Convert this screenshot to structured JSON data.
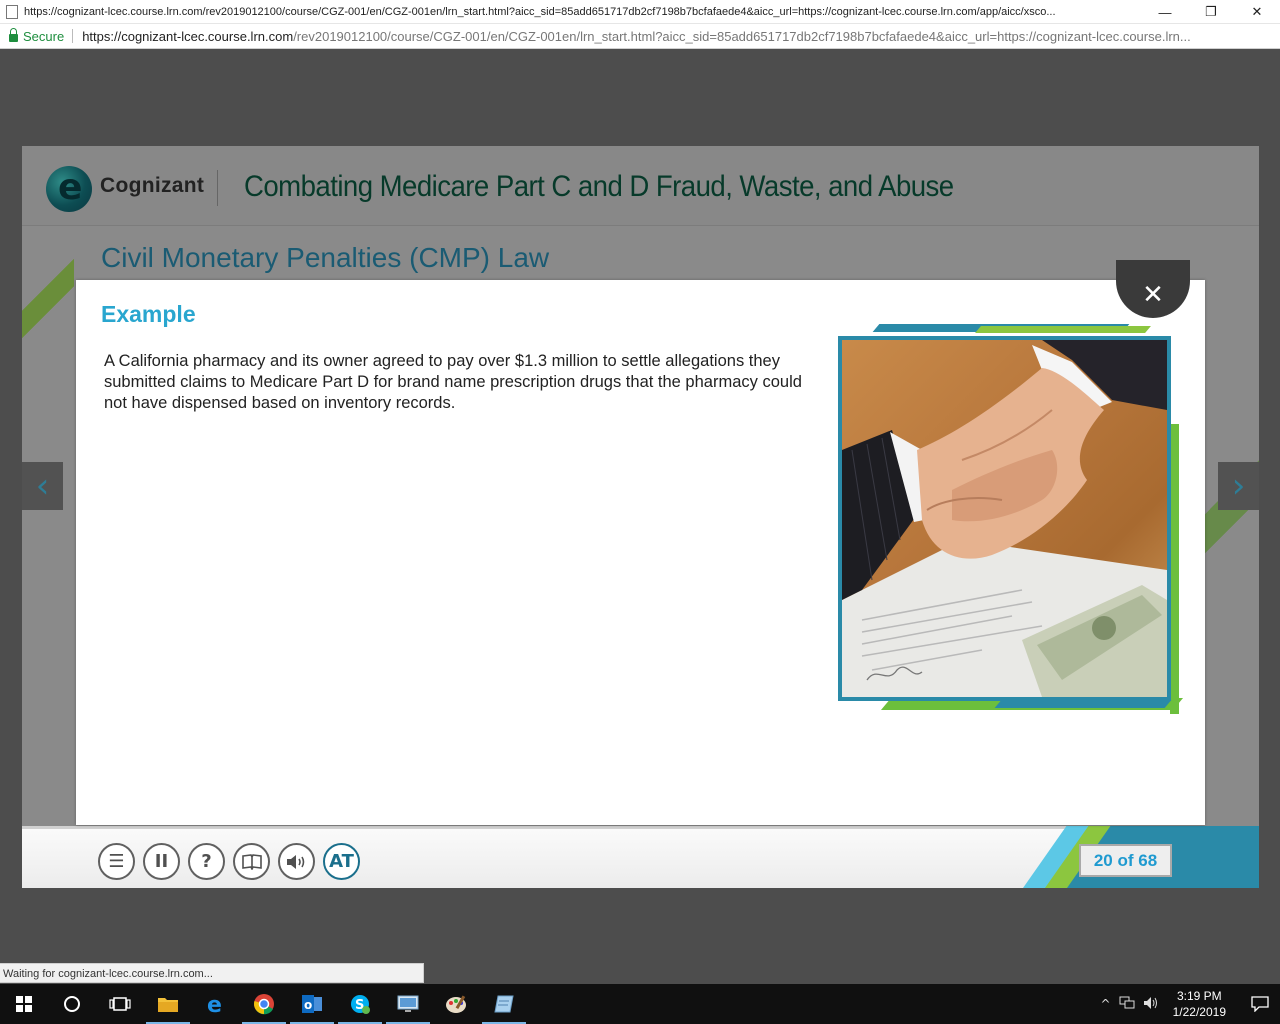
{
  "browser": {
    "window_title": "https://cognizant-lcec.course.lrn.com/rev2019012100/course/CGZ-001/en/CGZ-001en/lrn_start.html?aicc_sid=85add651717db2cf7198b7bcfafaede4&aicc_url=https://cognizant-lcec.course.lrn.com/app/aicc/xsco...",
    "minimize": "—",
    "restore": "❐",
    "close": "✕",
    "secure_label": "Secure",
    "url_host": "https://cognizant-lcec.course.lrn.com",
    "url_rest": "/rev2019012100/course/CGZ-001/en/CGZ-001en/lrn_start.html?aicc_sid=85add651717db2cf7198b7bcfafaede4&aicc_url=https://cognizant-lcec.course.lrn...",
    "status_text": "Waiting for cognizant-lcec.course.lrn.com..."
  },
  "course": {
    "logo_text": "Cognizant",
    "title": "Combating Medicare Part C and D Fraud, Waste, and Abuse",
    "slide_heading": "Civil Monetary Penalties (CMP) Law",
    "prev_arrow": "‹",
    "next_arrow": "›",
    "page_counter": "20 of 68",
    "controls": {
      "menu": "☰",
      "pause": "II",
      "help": "?",
      "glossary": "📖",
      "audio": "🔊",
      "accessibility": "AT"
    }
  },
  "modal": {
    "title": "Example",
    "body": "A California pharmacy and its owner agreed to pay over $1.3 million to settle allegations they submitted claims to Medicare Part D for brand name prescription drugs that the pharmacy could not have dispensed based on inventory records.",
    "close": "✕"
  },
  "taskbar": {
    "time": "3:19 PM",
    "date": "1/22/2019"
  },
  "colors": {
    "accent_blue": "#29a6cf",
    "accent_green": "#8cc63f",
    "teal": "#2a8aa8"
  }
}
